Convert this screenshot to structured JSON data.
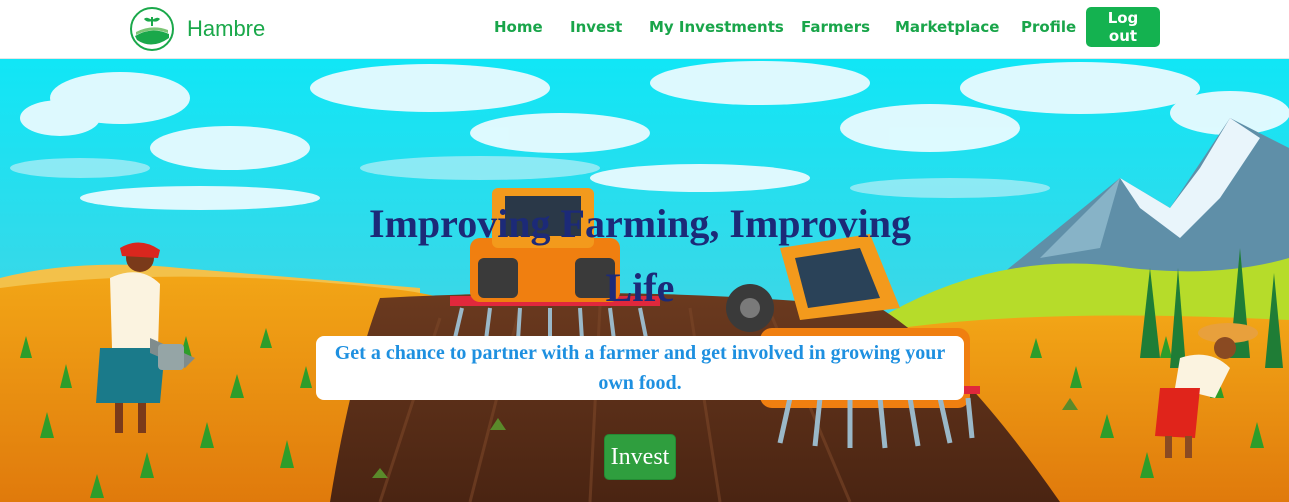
{
  "brand": {
    "name": "Hambre",
    "logo_icon": "farm-field-sprout-icon"
  },
  "nav": {
    "home": "Home",
    "invest": "Invest",
    "my_investments": "My Investments",
    "farmers": "Farmers",
    "marketplace": "Marketplace",
    "profile": "Profile",
    "logout": "Log out"
  },
  "hero": {
    "headline": "Improving Farming, Improving Life",
    "tagline": "Get a chance to partner with a farmer and get involved in growing your own food.",
    "cta": "Invest"
  },
  "colors": {
    "brand_green": "#19a54a",
    "logout_bg": "#14b250",
    "cta_bg": "#2f9e3e",
    "headline": "#1c2a78",
    "tagline": "#1e90e0",
    "sky": "#26d8ea"
  }
}
